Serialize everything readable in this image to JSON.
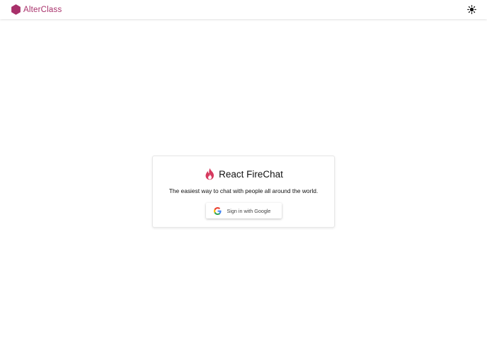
{
  "header": {
    "brand_name": "AlterClass",
    "brand_color": "#a8306a",
    "logo_icon": "hexagon-logo-icon",
    "theme_icon": "sun-icon"
  },
  "card": {
    "title": "React FireChat",
    "title_icon": "flame-icon",
    "subtitle": "The easiest way to chat with people all around the world.",
    "accent_color": "#d63a5f",
    "sign_in_button": {
      "label": "Sign in with Google",
      "icon": "google-icon"
    }
  }
}
